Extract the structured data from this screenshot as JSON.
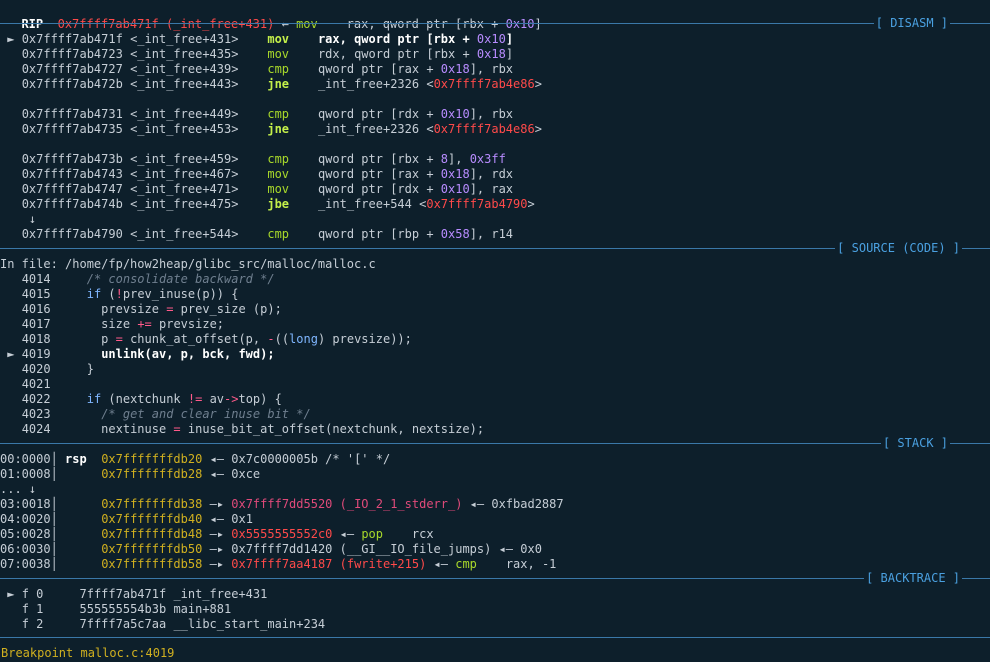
{
  "rip": {
    "label": "RIP",
    "addr": "0x7ffff7ab471f",
    "sym": "(_int_free+431)",
    "arrow": "←",
    "mnemonic": "mov",
    "operands_a": "rax, qword ptr [rbx + ",
    "operands_num": "0x10",
    "operands_b": "]"
  },
  "sections": {
    "disasm": "[ DISASM ]",
    "source": "[ SOURCE (CODE) ]",
    "stack": "[ STACK ]",
    "backtrace": "[ BACKTRACE ]"
  },
  "disasm": [
    {
      "marker": "►",
      "addr": "0x7ffff7ab471f",
      "sym": "<_int_free+431>",
      "mn": "mov",
      "current": true,
      "ops": [
        {
          "t": "rax, qword ptr [rbx + ",
          "c": "opb"
        },
        {
          "t": "0x10",
          "c": "num"
        },
        {
          "t": "]",
          "c": "opb"
        }
      ]
    },
    {
      "marker": "",
      "addr": "0x7ffff7ab4723",
      "sym": "<_int_free+435>",
      "mn": "mov",
      "ops": [
        {
          "t": "rdx, qword ptr [rbx + ",
          "c": "op"
        },
        {
          "t": "0x18",
          "c": "num"
        },
        {
          "t": "]",
          "c": "op"
        }
      ]
    },
    {
      "marker": "",
      "addr": "0x7ffff7ab4727",
      "sym": "<_int_free+439>",
      "mn": "cmp",
      "ops": [
        {
          "t": "qword ptr [rax + ",
          "c": "op"
        },
        {
          "t": "0x18",
          "c": "num"
        },
        {
          "t": "], rbx",
          "c": "op"
        }
      ]
    },
    {
      "marker": "",
      "addr": "0x7ffff7ab472b",
      "sym": "<_int_free+443>",
      "mn": "jne",
      "jump": true,
      "ops": [
        {
          "t": "_int_free+2326 ",
          "c": "op"
        },
        {
          "t": "<",
          "c": "op"
        },
        {
          "t": "0x7ffff7ab4e86",
          "c": "red"
        },
        {
          "t": ">",
          "c": "op"
        }
      ]
    },
    {
      "blank": true
    },
    {
      "marker": "",
      "addr": "0x7ffff7ab4731",
      "sym": "<_int_free+449>",
      "mn": "cmp",
      "ops": [
        {
          "t": "qword ptr [rdx + ",
          "c": "op"
        },
        {
          "t": "0x10",
          "c": "num"
        },
        {
          "t": "], rbx",
          "c": "op"
        }
      ]
    },
    {
      "marker": "",
      "addr": "0x7ffff7ab4735",
      "sym": "<_int_free+453>",
      "mn": "jne",
      "jump": true,
      "ops": [
        {
          "t": "_int_free+2326 ",
          "c": "op"
        },
        {
          "t": "<",
          "c": "op"
        },
        {
          "t": "0x7ffff7ab4e86",
          "c": "red"
        },
        {
          "t": ">",
          "c": "op"
        }
      ]
    },
    {
      "blank": true
    },
    {
      "marker": "",
      "addr": "0x7ffff7ab473b",
      "sym": "<_int_free+459>",
      "mn": "cmp",
      "ops": [
        {
          "t": "qword ptr [rbx + ",
          "c": "op"
        },
        {
          "t": "8",
          "c": "num"
        },
        {
          "t": "], ",
          "c": "op"
        },
        {
          "t": "0x3ff",
          "c": "num"
        }
      ]
    },
    {
      "marker": "",
      "addr": "0x7ffff7ab4743",
      "sym": "<_int_free+467>",
      "mn": "mov",
      "ops": [
        {
          "t": "qword ptr [rax + ",
          "c": "op"
        },
        {
          "t": "0x18",
          "c": "num"
        },
        {
          "t": "], rdx",
          "c": "op"
        }
      ]
    },
    {
      "marker": "",
      "addr": "0x7ffff7ab4747",
      "sym": "<_int_free+471>",
      "mn": "mov",
      "ops": [
        {
          "t": "qword ptr [rdx + ",
          "c": "op"
        },
        {
          "t": "0x10",
          "c": "num"
        },
        {
          "t": "], rax",
          "c": "op"
        }
      ]
    },
    {
      "marker": "",
      "addr": "0x7ffff7ab474b",
      "sym": "<_int_free+475>",
      "mn": "jbe",
      "jump": true,
      "ops": [
        {
          "t": "_int_free+544 ",
          "c": "op"
        },
        {
          "t": "<",
          "c": "op"
        },
        {
          "t": "0x7ffff7ab4790",
          "c": "red"
        },
        {
          "t": ">",
          "c": "op"
        }
      ]
    },
    {
      "downarrow": "↓"
    },
    {
      "marker": "",
      "addr": "0x7ffff7ab4790",
      "sym": "<_int_free+544>",
      "mn": "cmp",
      "ops": [
        {
          "t": "qword ptr [rbp + ",
          "c": "op"
        },
        {
          "t": "0x58",
          "c": "num"
        },
        {
          "t": "], r14",
          "c": "op"
        }
      ]
    }
  ],
  "source": {
    "file_line": "In file: /home/fp/how2heap/glibc_src/malloc/malloc.c",
    "lines": [
      {
        "n": "4014",
        "marker": "",
        "parts": [
          {
            "t": "    ",
            "c": ""
          },
          {
            "t": "/* consolidate backward */",
            "c": "cmt"
          }
        ]
      },
      {
        "n": "4015",
        "marker": "",
        "parts": [
          {
            "t": "    ",
            "c": ""
          },
          {
            "t": "if",
            "c": "kw"
          },
          {
            "t": " (",
            "c": ""
          },
          {
            "t": "!",
            "c": "opr"
          },
          {
            "t": "prev_inuse(p)) {",
            "c": ""
          }
        ]
      },
      {
        "n": "4016",
        "marker": "",
        "parts": [
          {
            "t": "      prevsize ",
            "c": ""
          },
          {
            "t": "=",
            "c": "opr"
          },
          {
            "t": " prev_size (p);",
            "c": ""
          }
        ]
      },
      {
        "n": "4017",
        "marker": "",
        "parts": [
          {
            "t": "      size ",
            "c": ""
          },
          {
            "t": "+=",
            "c": "opr"
          },
          {
            "t": " prevsize;",
            "c": ""
          }
        ]
      },
      {
        "n": "4018",
        "marker": "",
        "parts": [
          {
            "t": "      p ",
            "c": ""
          },
          {
            "t": "=",
            "c": "opr"
          },
          {
            "t": " chunk_at_offset(p, ",
            "c": ""
          },
          {
            "t": "-",
            "c": "opr"
          },
          {
            "t": "((",
            "c": ""
          },
          {
            "t": "long",
            "c": "typ"
          },
          {
            "t": ") prevsize));",
            "c": ""
          }
        ]
      },
      {
        "n": "4019",
        "marker": "►",
        "parts": [
          {
            "t": "      ",
            "c": ""
          },
          {
            "t": "unlink(av, p, bck, fwd);",
            "c": "bold"
          }
        ]
      },
      {
        "n": "4020",
        "marker": "",
        "parts": [
          {
            "t": "    }",
            "c": ""
          }
        ]
      },
      {
        "n": "4021",
        "marker": "",
        "parts": []
      },
      {
        "n": "4022",
        "marker": "",
        "parts": [
          {
            "t": "    ",
            "c": ""
          },
          {
            "t": "if",
            "c": "kw"
          },
          {
            "t": " (nextchunk ",
            "c": ""
          },
          {
            "t": "!=",
            "c": "opr"
          },
          {
            "t": " av",
            "c": ""
          },
          {
            "t": "->",
            "c": "opr"
          },
          {
            "t": "top) {",
            "c": ""
          }
        ]
      },
      {
        "n": "4023",
        "marker": "",
        "parts": [
          {
            "t": "      ",
            "c": ""
          },
          {
            "t": "/* get and clear inuse bit */",
            "c": "cmt"
          }
        ]
      },
      {
        "n": "4024",
        "marker": "",
        "parts": [
          {
            "t": "      nextinuse ",
            "c": ""
          },
          {
            "t": "=",
            "c": "opr"
          },
          {
            "t": " inuse_bit_at_offset(nextchunk, nextsize);",
            "c": ""
          }
        ]
      }
    ]
  },
  "stack": [
    {
      "idx": "00:0000",
      "bar": "│",
      "reg": "rsp",
      "parts": [
        {
          "t": "0x7fffffffdb20",
          "c": "yel"
        },
        {
          "t": " ◂— ",
          "c": "arrow"
        },
        {
          "t": "0x7c0000005b /* '[' */",
          "c": ""
        }
      ]
    },
    {
      "idx": "01:0008",
      "bar": "│",
      "reg": "",
      "parts": [
        {
          "t": "0x7fffffffdb28",
          "c": "yel"
        },
        {
          "t": " ◂— ",
          "c": "arrow"
        },
        {
          "t": "0xce",
          "c": ""
        }
      ]
    },
    {
      "idx": "... ↓",
      "bar": "",
      "reg": "",
      "parts": []
    },
    {
      "idx": "03:0018",
      "bar": "│",
      "reg": "",
      "parts": [
        {
          "t": "0x7fffffffdb38",
          "c": "yel"
        },
        {
          "t": " —▸ ",
          "c": "arrow"
        },
        {
          "t": "0x7ffff7dd5520 (_IO_2_1_stderr_)",
          "c": "pink"
        },
        {
          "t": " ◂— ",
          "c": "arrow"
        },
        {
          "t": "0xfbad2887",
          "c": ""
        }
      ]
    },
    {
      "idx": "04:0020",
      "bar": "│",
      "reg": "",
      "parts": [
        {
          "t": "0x7fffffffdb40",
          "c": "yel"
        },
        {
          "t": " ◂— ",
          "c": "arrow"
        },
        {
          "t": "0x1",
          "c": ""
        }
      ]
    },
    {
      "idx": "05:0028",
      "bar": "│",
      "reg": "",
      "parts": [
        {
          "t": "0x7fffffffdb48",
          "c": "yel"
        },
        {
          "t": " —▸ ",
          "c": "arrow"
        },
        {
          "t": "0x5555555552c0",
          "c": "red"
        },
        {
          "t": " ◂— ",
          "c": "arrow"
        },
        {
          "t": "pop",
          "c": "mn"
        },
        {
          "t": "    rcx",
          "c": ""
        }
      ]
    },
    {
      "idx": "06:0030",
      "bar": "│",
      "reg": "",
      "parts": [
        {
          "t": "0x7fffffffdb50",
          "c": "yel"
        },
        {
          "t": " —▸ ",
          "c": "arrow"
        },
        {
          "t": "0x7ffff7dd1420 (__GI__IO_file_jumps)",
          "c": ""
        },
        {
          "t": " ◂— ",
          "c": "arrow"
        },
        {
          "t": "0x0",
          "c": ""
        }
      ]
    },
    {
      "idx": "07:0038",
      "bar": "│",
      "reg": "",
      "parts": [
        {
          "t": "0x7fffffffdb58",
          "c": "yel"
        },
        {
          "t": " —▸ ",
          "c": "arrow"
        },
        {
          "t": "0x7ffff7aa4187 (fwrite+215)",
          "c": "red"
        },
        {
          "t": " ◂— ",
          "c": "arrow"
        },
        {
          "t": "cmp",
          "c": "mn"
        },
        {
          "t": "    rax, -1",
          "c": ""
        }
      ]
    }
  ],
  "backtrace": [
    {
      "marker": "►",
      "frame": "f 0",
      "addr": "7ffff7ab471f",
      "sym": "_int_free+431"
    },
    {
      "marker": "",
      "frame": "f 1",
      "addr": "555555554b3b",
      "sym": "main+881"
    },
    {
      "marker": "",
      "frame": "f 2",
      "addr": "7ffff7a5c7aa",
      "sym": "__libc_start_main+234"
    }
  ],
  "status": "Breakpoint malloc.c:4019"
}
